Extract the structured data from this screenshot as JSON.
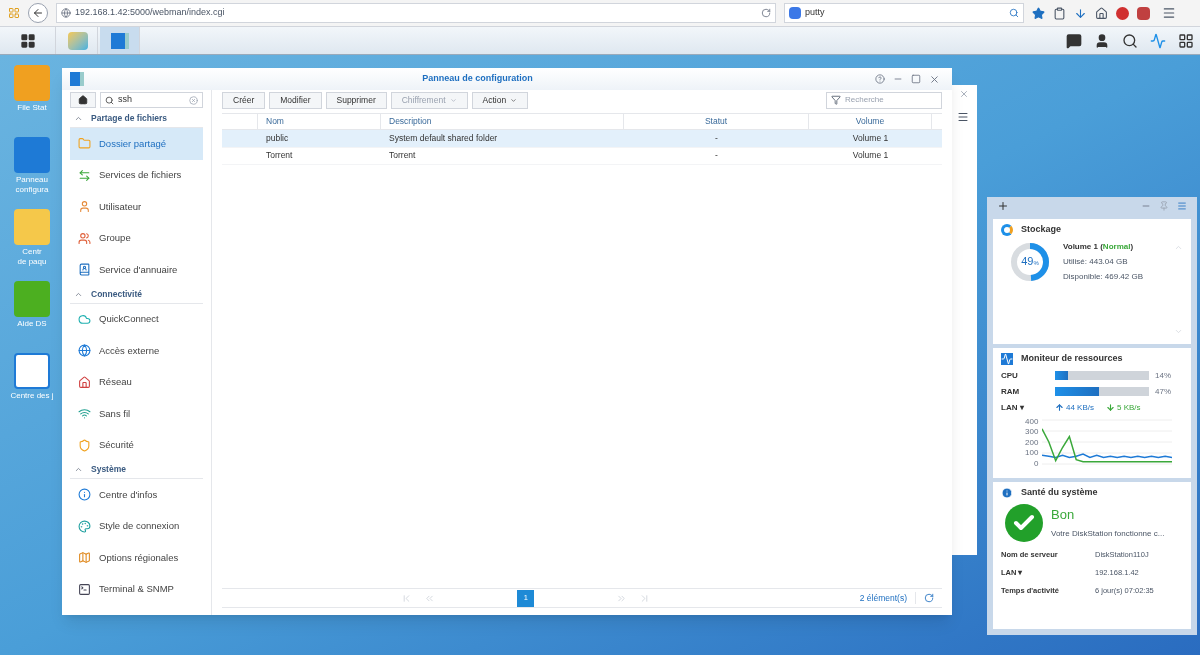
{
  "browser": {
    "url": "192.168.1.42:5000/webman/index.cgi",
    "search_value": "putty"
  },
  "desktop_icons": [
    {
      "label": "File Stat"
    },
    {
      "label": "Panneau\nconfigura"
    },
    {
      "label": "Centr\nde paqu"
    },
    {
      "label": "Aide DS"
    },
    {
      "label": "Centre des j"
    }
  ],
  "taskbar": {
    "apps": [
      {
        "selected": false
      },
      {
        "selected": true
      }
    ]
  },
  "window": {
    "title": "Panneau de configuration",
    "sidebar": {
      "search_value": "ssh",
      "sections": [
        {
          "title": "Partage de fichiers",
          "expanded": true,
          "items": [
            {
              "label": "Dossier partagé",
              "selected": true
            },
            {
              "label": "Services de fichiers",
              "selected": false
            },
            {
              "label": "Utilisateur",
              "selected": false
            },
            {
              "label": "Groupe",
              "selected": false
            },
            {
              "label": "Service d'annuaire",
              "selected": false
            }
          ]
        },
        {
          "title": "Connectivité",
          "expanded": true,
          "items": [
            {
              "label": "QuickConnect",
              "selected": false
            },
            {
              "label": "Accès externe",
              "selected": false
            },
            {
              "label": "Réseau",
              "selected": false
            },
            {
              "label": "Sans fil",
              "selected": false
            },
            {
              "label": "Sécurité",
              "selected": false
            }
          ]
        },
        {
          "title": "Système",
          "expanded": true,
          "items": [
            {
              "label": "Centre d'infos",
              "selected": false
            },
            {
              "label": "Style de connexion",
              "selected": false
            },
            {
              "label": "Options régionales",
              "selected": false
            },
            {
              "label": "Terminal & SNMP",
              "selected": false
            }
          ]
        }
      ]
    },
    "toolbar": [
      {
        "label": "Créer",
        "dropdown": false,
        "disabled": false
      },
      {
        "label": "Modifier",
        "dropdown": false,
        "disabled": false
      },
      {
        "label": "Supprimer",
        "dropdown": false,
        "disabled": false
      },
      {
        "label": "Chiffrement",
        "dropdown": true,
        "disabled": true
      },
      {
        "label": "Action",
        "dropdown": true,
        "disabled": false
      }
    ],
    "filter_placeholder": "Recherche",
    "table": {
      "columns": [
        "Nom",
        "Description",
        "Statut",
        "Volume"
      ],
      "rows": [
        {
          "cells": [
            "public",
            "System default shared folder",
            "-",
            "Volume 1"
          ],
          "selected": true
        },
        {
          "cells": [
            "Torrent",
            "Torrent",
            "-",
            "Volume 1"
          ],
          "selected": false
        }
      ]
    },
    "pagination": {
      "pages": [
        {
          "label": "1",
          "selected": true
        }
      ],
      "count": "2 élément(s)"
    }
  },
  "widgets": {
    "storage": {
      "title": "Stockage",
      "level": 0.49,
      "percent": "49",
      "unit": "%",
      "volume": "Volume 1 (**Normal**)",
      "used": "Utilisé: 443.04 GB",
      "free": "Disponible: 469.42 GB"
    },
    "monitor": {
      "title": "Moniteur de ressources",
      "meters": [
        {
          "label": "CPU",
          "level": 0.14,
          "reading": "14%"
        },
        {
          "label": "RAM",
          "level": 0.47,
          "reading": "47%"
        }
      ],
      "lan_label": "LAN ▾",
      "upload": "44 KB/s",
      "download": "5 KB/s",
      "chart_data": {
        "type": "line",
        "grid": true,
        "ylim": [
          0,
          400
        ],
        "yticks": [
          0,
          100,
          200,
          300,
          400
        ],
        "series": [
          {
            "color": "#1e7ad6",
            "values": [
              80,
              70,
              60,
              80,
              60,
              70,
              90,
              60,
              80,
              60,
              70,
              60,
              70,
              60,
              70,
              60,
              70,
              60,
              70,
              60
            ]
          },
          {
            "color": "#3aa83a",
            "values": [
              320,
              200,
              30,
              150,
              250,
              40,
              20,
              20,
              20,
              20,
              20,
              20,
              20,
              20,
              20,
              20,
              20,
              20,
              20,
              20
            ]
          }
        ]
      }
    },
    "health": {
      "title": "Santé du système",
      "status": "Bon",
      "message": "Votre DiskStation fonctionne c...",
      "rows": [
        {
          "label": "Nom de serveur",
          "value": "DiskStation110J"
        },
        {
          "label": "LAN ▾",
          "value": "192.168.1.42"
        },
        {
          "label": "Temps d'activité",
          "value": "6 jour(s) 07:02:35"
        }
      ]
    }
  }
}
